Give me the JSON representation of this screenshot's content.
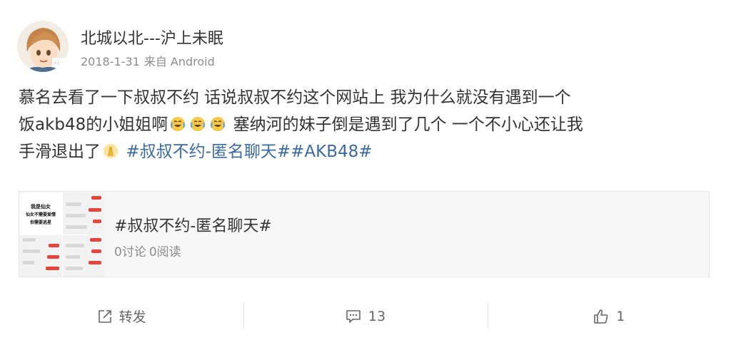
{
  "post": {
    "author": "北城以北---沪上未眠",
    "date": "2018-1-31",
    "source": "来自 Android",
    "text": {
      "line1": "慕名去看了一下叔叔不约 话说叔叔不约这个网站上 我为什么就没有遇到一个",
      "line2_a": "饭akb48的小姐姐啊",
      "line2_b": " 塞纳河的妹子倒是遇到了几个 一个不小心还让我",
      "line3_a": "手滑退出了",
      "line3_tags": "#叔叔不约-匿名聊天##AKB48#"
    },
    "emoji_icons": [
      "laugh-cry-emoji",
      "laugh-cry-emoji",
      "laugh-cry-emoji",
      "pray-emoji"
    ]
  },
  "card": {
    "title": "#叔叔不约-匿名聊天#",
    "discussions": "0讨论",
    "reads": "0阅读",
    "thumb_text": [
      "我是仙女",
      "仙女不需要爱情",
      "但需要逃星"
    ]
  },
  "actions": {
    "repost": "转发",
    "comments": "13",
    "likes": "1"
  },
  "colors": {
    "tag": "#3b6aa3",
    "meta": "#8c8c8c",
    "chat_red": "#e6443a"
  }
}
